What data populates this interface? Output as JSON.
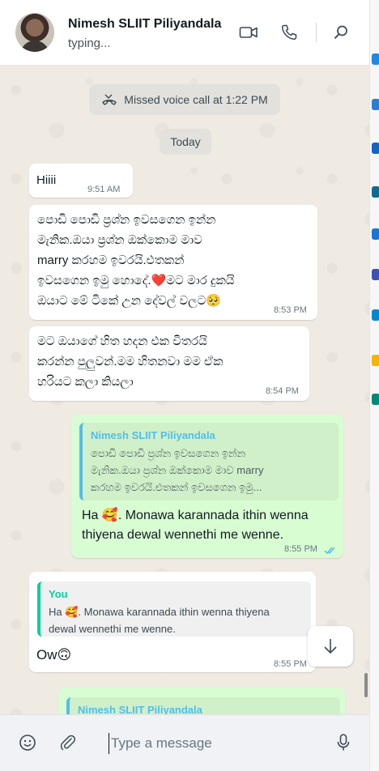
{
  "header": {
    "contact_name": "Nimesh SLIIT Piliyandala",
    "status": "typing..."
  },
  "icons": {
    "video": "video-call-icon",
    "phone": "voice-call-icon",
    "search": "search-icon",
    "missed_call": "missed-call-icon",
    "emoji": "emoji-icon",
    "attach": "paperclip-icon",
    "mic": "microphone-icon",
    "scroll_down": "chevron-down-icon",
    "read_receipt": "double-check-icon"
  },
  "system": {
    "missed_call": "Missed voice call at 1:22 PM",
    "date_divider": "Today"
  },
  "messages": [
    {
      "text": "Hiiii",
      "time": "9:51 AM"
    },
    {
      "lines": [
        "පොඩි පොඩි ප්‍රශ්න ඉවසගෙන ඉන්න",
        "මැනික.ඔයා ප්‍රශ්න ඔක්කොම මාව",
        "marry කරහම ඉවරයි.එතකන්",
        "ඉවසගෙන ඉමු හොදේ.❤️මට මාර දුකයි",
        "ඔයාට මේ ටිකේ උන දේවල් වලට🥺"
      ],
      "time": "8:53 PM"
    },
    {
      "lines": [
        "මට ඔයාගේ හිත හදන එක විතරයි",
        "කරන්න පුලුවන්.මම හිතනවා මම ඒක",
        "හරියට කලා කියලා"
      ],
      "time": "8:54 PM"
    },
    {
      "quote_name": "Nimesh SLIIT Piliyandala",
      "quote_lines": [
        "පොඩි පොඩි ප්‍රශ්න ඉවසගෙන ඉන්න",
        "මැනික.ඔයා ප්‍රශ්න ඔක්කොම මාව marry",
        "කරහම ඉවරයි.එතකන් ඉවසගෙන ඉමු..."
      ],
      "lines": [
        "Ha 🥰. Monawa karannada ithin wenna",
        "thiyena dewal wennethi me wenne."
      ],
      "time": "8:55 PM"
    },
    {
      "quote_name": "You",
      "quote_lines": [
        "Ha 🥰. Monawa karannada ithin wenna thiyena",
        "dewal wennethi me wenne."
      ],
      "text": "Ow🙃",
      "time": "8:55 PM"
    },
    {
      "quote_name": "Nimesh SLIIT Piliyandala"
    }
  ],
  "composer": {
    "placeholder": "Type a message"
  },
  "colors": {
    "chat_bg": "#efeae2",
    "outgoing_bubble": "#d9fdd3",
    "incoming_bubble": "#ffffff",
    "quote_you": "#06cf9c",
    "quote_other": "#53bdeb",
    "read_tick": "#53bdeb"
  }
}
